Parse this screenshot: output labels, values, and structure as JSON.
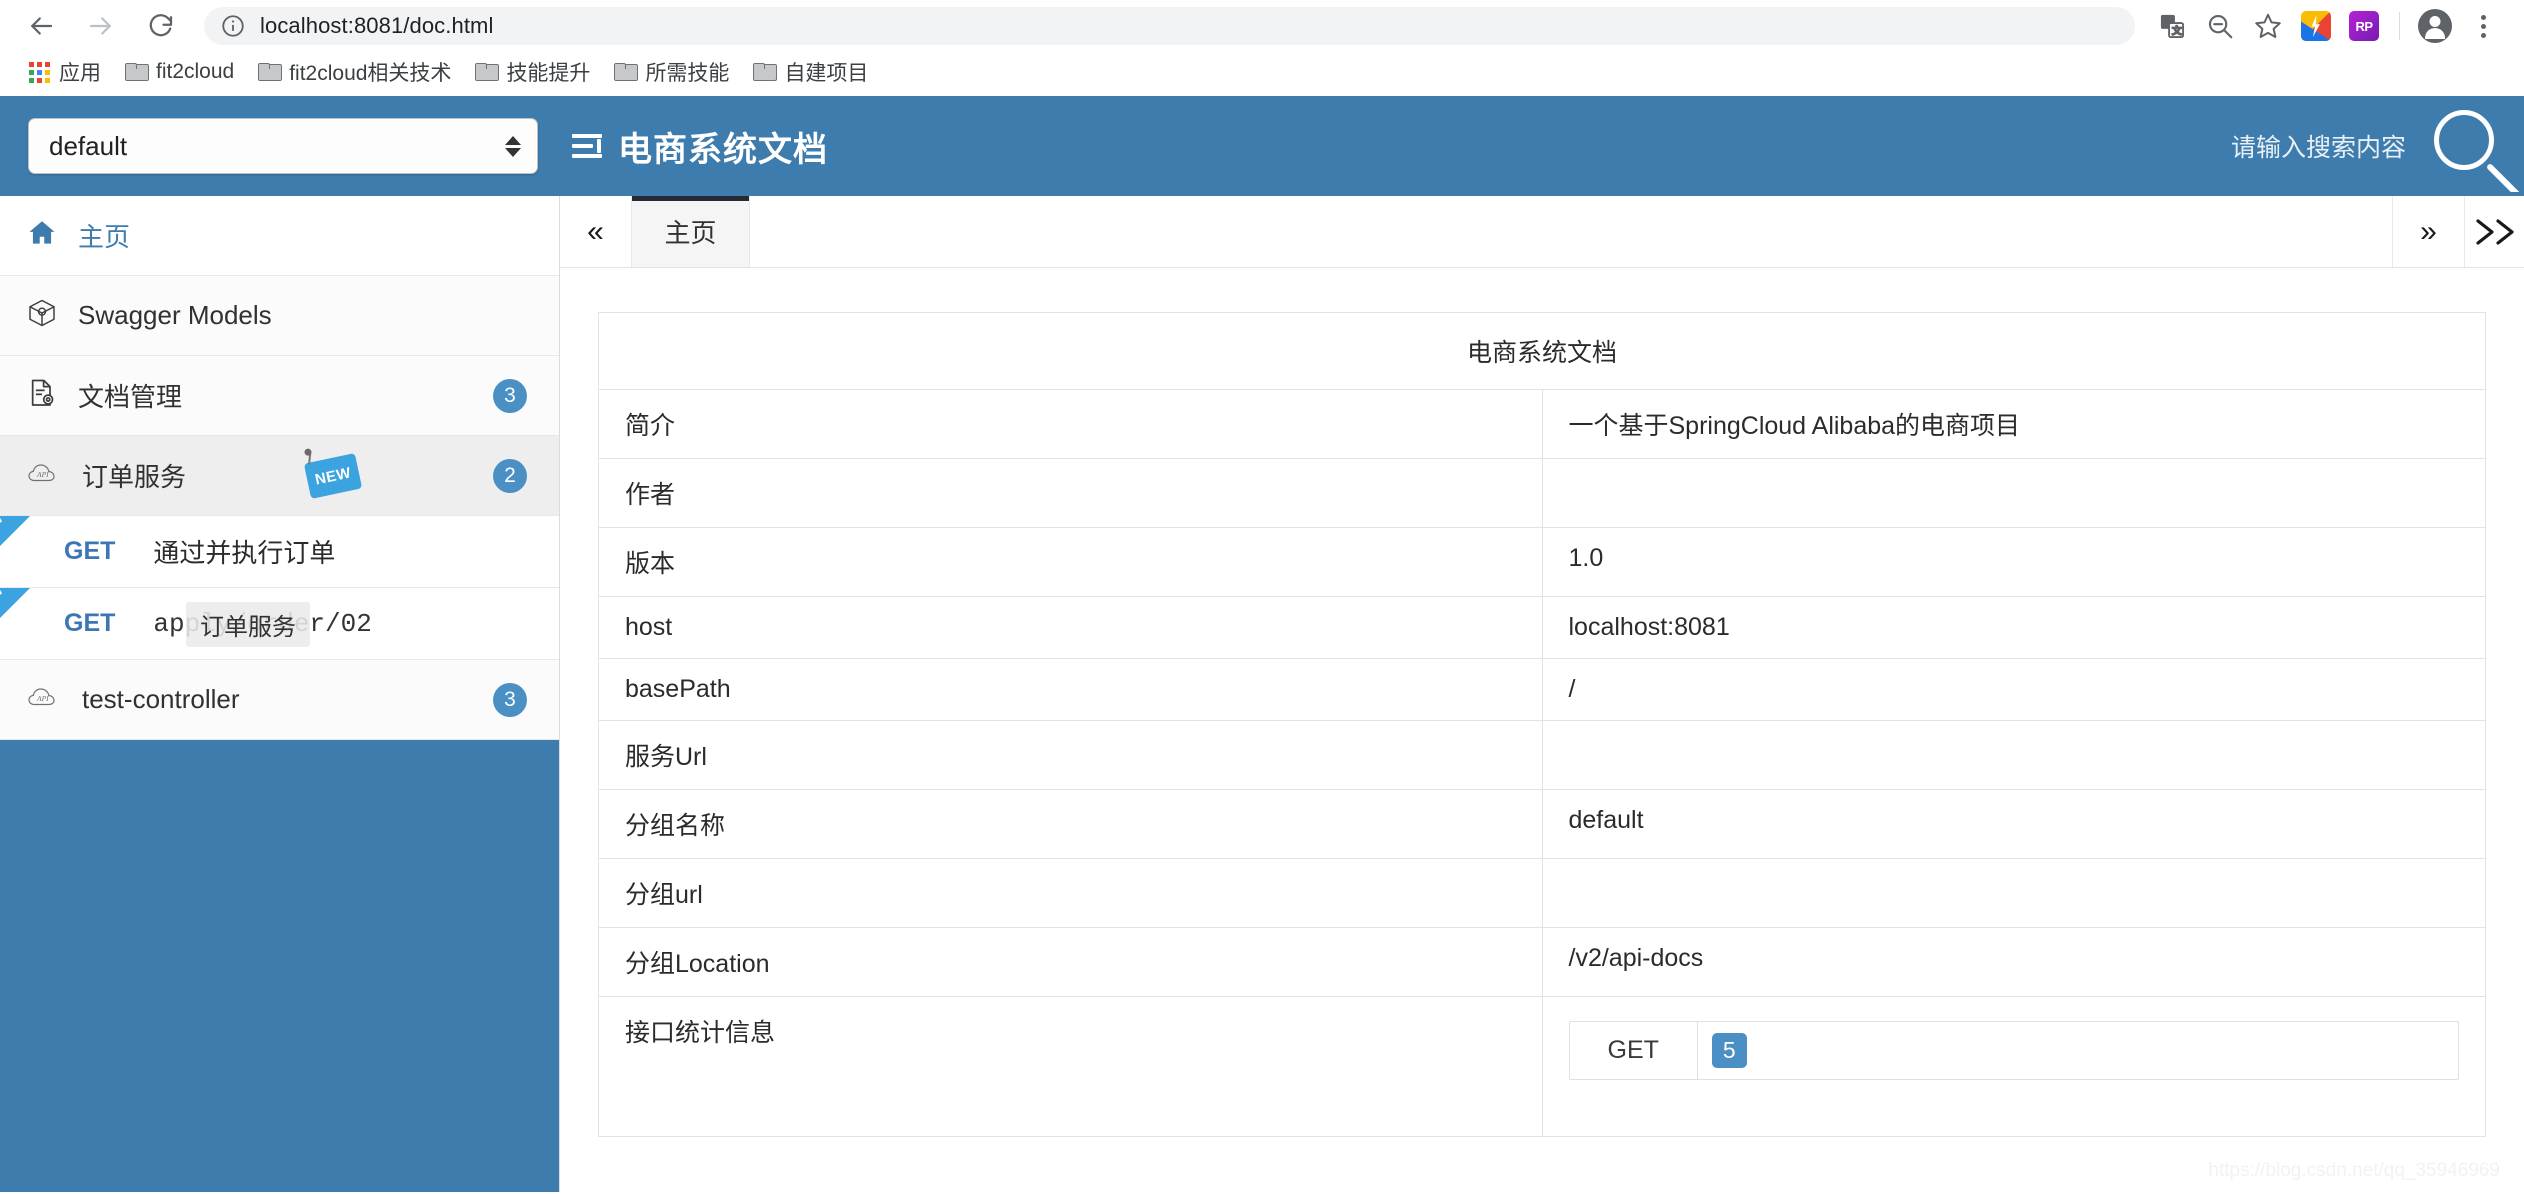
{
  "browser": {
    "back_label": "back",
    "forward_label": "forward",
    "reload_label": "reload",
    "url_scheme_host": "localhost:8081",
    "url_path": "/doc.html",
    "url_full": "localhost:8081/doc.html",
    "icons": {
      "site_info": "info-icon",
      "translate": "translate-icon",
      "zoom_out": "zoom-out-icon",
      "bookmark": "star-icon",
      "extension_1": "extension-lightning-icon",
      "extension_2": "extension-rp-icon",
      "profile": "avatar-icon",
      "menu": "kebab-menu-icon"
    },
    "extension_2_label": "RP",
    "bookmarks": [
      {
        "label": "应用",
        "icon": "apps-grid-icon"
      },
      {
        "label": "fit2cloud",
        "icon": "folder-icon"
      },
      {
        "label": "fit2cloud相关技术",
        "icon": "folder-icon"
      },
      {
        "label": "技能提升",
        "icon": "folder-icon"
      },
      {
        "label": "所需技能",
        "icon": "folder-icon"
      },
      {
        "label": "自建项目",
        "icon": "folder-icon"
      }
    ]
  },
  "header": {
    "group_select_value": "default",
    "title": "电商系统文档",
    "search_placeholder": "请输入搜索内容",
    "brand_color": "#3e7cad"
  },
  "sidebar": {
    "items": [
      {
        "label": "主页",
        "icon": "home-icon",
        "badge": "",
        "new": false
      },
      {
        "label": "Swagger Models",
        "icon": "cube-icon",
        "badge": "",
        "new": false
      },
      {
        "label": "文档管理",
        "icon": "document-gear-icon",
        "badge": "3",
        "new": false
      },
      {
        "label": "订单服务",
        "icon": "api-cloud-icon",
        "badge": "2",
        "new": true
      },
      {
        "label": "test-controller",
        "icon": "api-cloud-icon",
        "badge": "3",
        "new": false
      }
    ],
    "api_items": [
      {
        "method": "GET",
        "name": "通过并执行订单",
        "ribbon": "NEW",
        "mono": false
      },
      {
        "method": "GET",
        "name": "apply/order/02",
        "ribbon": "NEW",
        "mono": true
      }
    ],
    "tooltip": "订单服务"
  },
  "tabs": {
    "scroll_left": "«",
    "scroll_right": "»",
    "items": [
      {
        "label": "主页",
        "active": true
      }
    ]
  },
  "document": {
    "table_title": "电商系统文档",
    "rows": [
      {
        "key": "简介",
        "value": "一个基于SpringCloud Alibaba的电商项目"
      },
      {
        "key": "作者",
        "value": ""
      },
      {
        "key": "版本",
        "value": "1.0"
      },
      {
        "key": "host",
        "value": "localhost:8081"
      },
      {
        "key": "basePath",
        "value": "/"
      },
      {
        "key": "服务Url",
        "value": ""
      },
      {
        "key": "分组名称",
        "value": "default"
      },
      {
        "key": "分组url",
        "value": ""
      },
      {
        "key": "分组Location",
        "value": "/v2/api-docs"
      }
    ],
    "stats_key": "接口统计信息",
    "stats_method": "GET",
    "stats_count": "5"
  },
  "watermark": "https://blog.csdn.net/qq_35946969"
}
